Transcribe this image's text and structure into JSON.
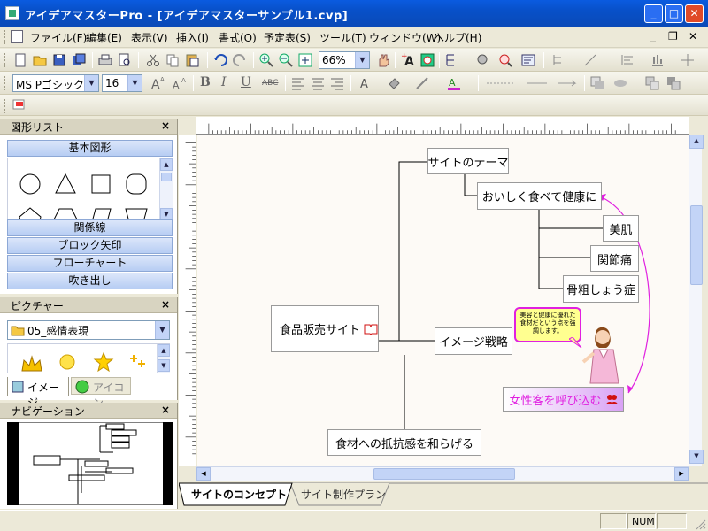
{
  "window": {
    "title": "アイデアマスターPro - [アイデアマスターサンプル1.cvp]",
    "minimize": "_",
    "maximize": "□",
    "close": "✕"
  },
  "menu": [
    "ファイル(F)",
    "編集(E)",
    "表示(V)",
    "挿入(I)",
    "書式(O)",
    "予定表(S)",
    "ツール(T)",
    "ウィンドウ(W)",
    "ヘルプ(H)"
  ],
  "mdi": {
    "minimize": "_",
    "restore": "❐",
    "close": "✕"
  },
  "toolbar": {
    "zoom": "66%"
  },
  "format": {
    "font": "MS Pゴシック",
    "size": "16",
    "bold": "B",
    "italic": "I",
    "underline": "U",
    "abc": "ABC"
  },
  "shapes_panel": {
    "title": "図形リスト",
    "close": "×",
    "category_top": "基本図形",
    "categories": [
      "関係線",
      "ブロック矢印",
      "フローチャート",
      "吹き出し"
    ]
  },
  "picture_panel": {
    "title": "ピクチャー",
    "close": "×",
    "folder": "05_感情表現",
    "tabs": [
      "イメージ",
      "アイコン"
    ]
  },
  "nav_panel": {
    "title": "ナビゲーション",
    "close": "×"
  },
  "mindmap": {
    "root": "食品販売サイト",
    "nodes": {
      "theme": "サイトのテーマ",
      "oishiku": "おいしく食べて健康に",
      "bihada": "美肌",
      "kansetsu": "関節痛",
      "kotsuso": "骨粗しょう症",
      "image": "イメージ戦略",
      "josei": "女性客を呼び込む",
      "shokuzai": "食材への抵抗感を和らげる"
    },
    "callout": "美容と健康に優れた食材だという点を強調します。",
    "accent": "#e020e0",
    "highlight": "#d9a2f5"
  },
  "sheet_tabs": [
    "サイトのコンセプト",
    "サイト制作プラン"
  ],
  "status": {
    "num": "NUM"
  }
}
